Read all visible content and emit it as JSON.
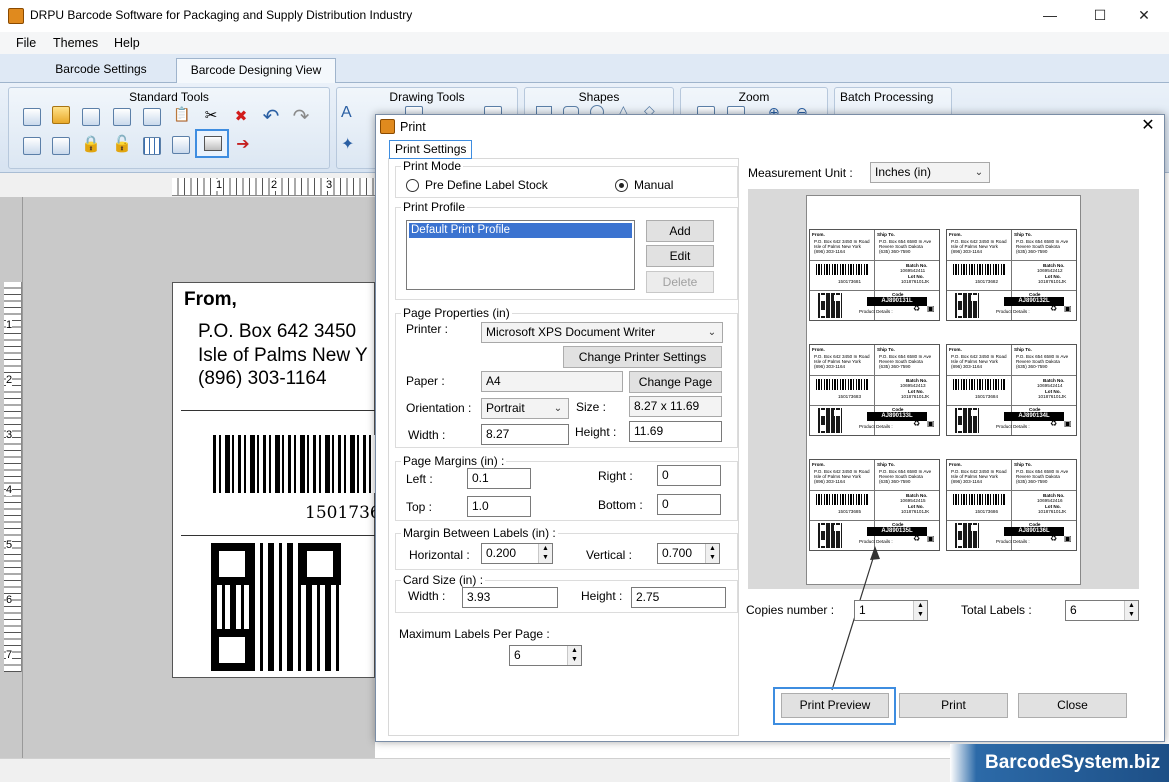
{
  "window": {
    "title": "DRPU Barcode Software for Packaging and Supply Distribution Industry",
    "minimize": "—",
    "maximize": "☐",
    "close": "✕"
  },
  "menu": [
    "File",
    "Themes",
    "Help"
  ],
  "tabs": [
    "Barcode Settings",
    "Barcode Designing View"
  ],
  "ribbon": {
    "groups": [
      "Standard Tools",
      "Drawing Tools",
      "Shapes",
      "Zoom",
      "Batch Processing"
    ]
  },
  "ruler": {
    "top": [
      "1",
      "2",
      "3"
    ],
    "left": [
      "1",
      "2",
      "3",
      "4",
      "5",
      "6",
      "7"
    ]
  },
  "label": {
    "from": "From,",
    "line1": "P.O. Box 642 3450",
    "line2": "Isle of Palms New Y",
    "line3": "(896) 303-1164",
    "barcode_num": "1501736"
  },
  "dialog": {
    "title": "Print",
    "close": "✕",
    "settings_tab": "Print Settings",
    "print_mode": {
      "legend": "Print Mode",
      "option_predefine": "Pre Define Label Stock",
      "option_manual": "Manual",
      "selected": "Manual"
    },
    "print_profile": {
      "legend": "Print Profile",
      "items": [
        "Default Print Profile"
      ],
      "add": "Add",
      "edit": "Edit",
      "delete": "Delete"
    },
    "page_properties": {
      "legend": "Page Properties (in)",
      "printer_label": "Printer :",
      "printer_value": "Microsoft XPS Document Writer",
      "change_printer": "Change Printer Settings",
      "paper_label": "Paper :",
      "paper_value": "A4",
      "change_page": "Change Page",
      "orientation_label": "Orientation :",
      "orientation_value": "Portrait",
      "size_label": "Size :",
      "size_value": "8.27 x 11.69",
      "width_label": "Width :",
      "width_value": "8.27",
      "height_label": "Height :",
      "height_value": "11.69"
    },
    "page_margins": {
      "legend": "Page Margins (in) :",
      "left_label": "Left :",
      "left_value": "0.1",
      "right_label": "Right :",
      "right_value": "0",
      "top_label": "Top :",
      "top_value": "1.0",
      "bottom_label": "Bottom :",
      "bottom_value": "0"
    },
    "margin_between": {
      "legend": "Margin Between Labels (in) :",
      "horizontal_label": "Horizontal :",
      "horizontal_value": "0.200",
      "vertical_label": "Vertical :",
      "vertical_value": "0.700"
    },
    "card_size": {
      "legend": "Card Size (in) :",
      "width_label": "Width :",
      "width_value": "3.93",
      "height_label": "Height :",
      "height_value": "2.75"
    },
    "max_labels_label": "Maximum Labels Per Page :",
    "max_labels_value": "6",
    "measurement_label": "Measurement Unit :",
    "measurement_value": "Inches (in)",
    "copies_label": "Copies number :",
    "copies_value": "1",
    "total_label": "Total Labels :",
    "total_value": "6",
    "print_preview": "Print Preview",
    "print": "Print",
    "close_btn": "Close"
  },
  "preview": {
    "from": "From.",
    "ship_to": "Ship To.",
    "from_addr1": "P.O. Box 642 3450 In Road",
    "from_addr2": "Isle of Palms New York",
    "from_addr3": "(896) 303-1164",
    "ship_addr1": "P.O. Box 654 6580 In Ave",
    "ship_addr2": "Revere South Dakota",
    "ship_addr3": "(635) 360-7590",
    "batch_label": "Batch No.",
    "lot_label": "Lot No.",
    "lot_value": "101876101JK",
    "code_label": "Code",
    "product_details": "Product Details :",
    "cards": [
      {
        "batch": "1069542411",
        "code": "AJ890131L",
        "num": "150173681"
      },
      {
        "batch": "1069542412",
        "code": "AJ890132L",
        "num": "150173682"
      },
      {
        "batch": "1069542413",
        "code": "AJ890133L",
        "num": "150173683"
      },
      {
        "batch": "1069542414",
        "code": "AJ890134L",
        "num": "150173684"
      },
      {
        "batch": "1069542415",
        "code": "AJ890135L",
        "num": "150173685"
      },
      {
        "batch": "1069542416",
        "code": "AJ890136L",
        "num": "150173686"
      }
    ]
  },
  "footer": {
    "brand": "BarcodeSystem.biz"
  }
}
